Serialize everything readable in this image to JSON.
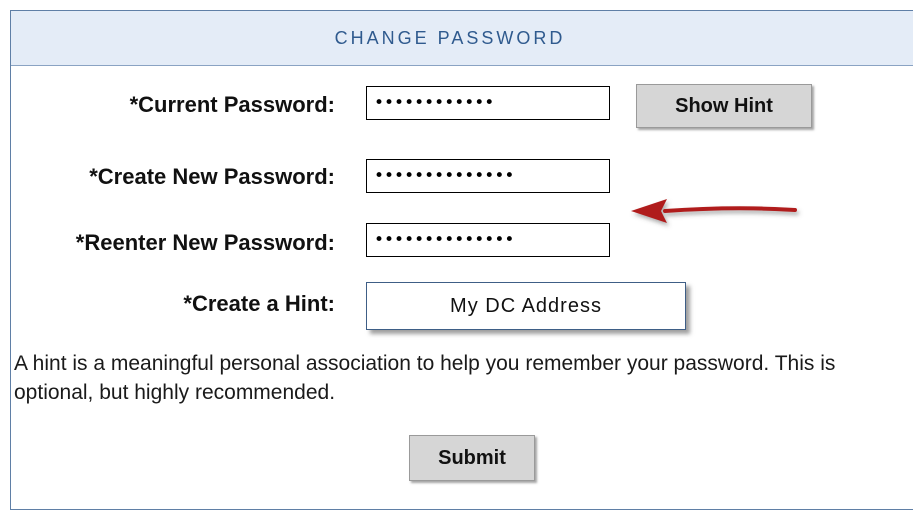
{
  "panel": {
    "title": "CHANGE PASSWORD"
  },
  "form": {
    "current_password": {
      "label": "*Current Password:",
      "value": "••••••••••••"
    },
    "show_hint_label": "Show Hint",
    "new_password": {
      "label": "*Create New Password:",
      "value": "••••••••••••••"
    },
    "reenter_password": {
      "label": "*Reenter New Password:",
      "value": "••••••••••••••"
    },
    "hint": {
      "label": "*Create a Hint:",
      "value": "My DC Address"
    },
    "help_text": "A hint is a meaningful personal association to help you remember your password. This is optional, but highly recommended.",
    "submit_label": "Submit"
  },
  "colors": {
    "header_background": "#e4ecf7",
    "header_text": "#2f5a8e",
    "border": "#5f7fa6",
    "button_background": "#d6d6d6",
    "arrow": "#b01a1a"
  },
  "annotation": {
    "arrow_icon": "red-arrow-pointing-left"
  }
}
